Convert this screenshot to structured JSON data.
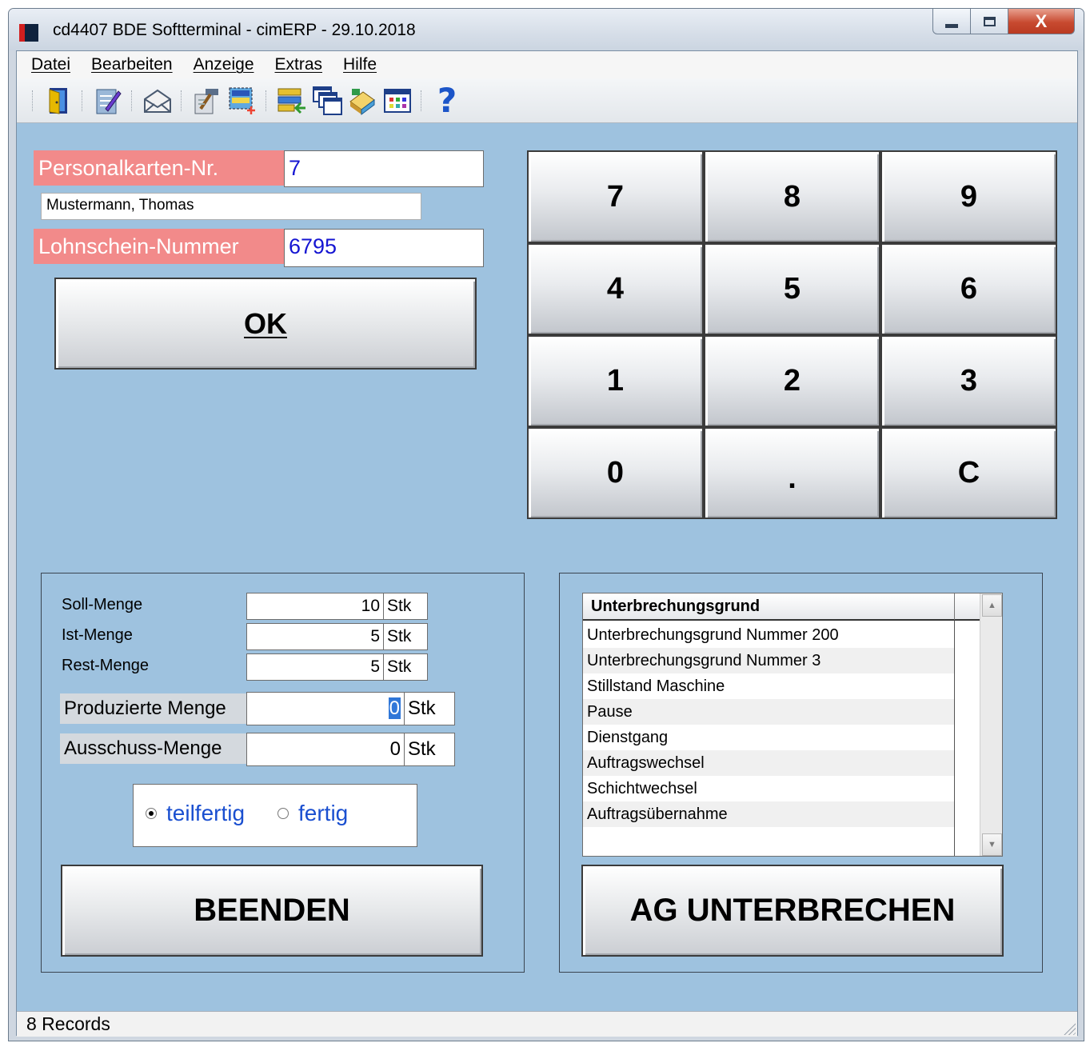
{
  "window": {
    "title": "cd4407 BDE Softterminal - cimERP - 29.10.2018",
    "close_glyph": "X"
  },
  "menu": [
    {
      "label": "Datei"
    },
    {
      "label": "Bearbeiten"
    },
    {
      "label": "Anzeige"
    },
    {
      "label": "Extras"
    },
    {
      "label": "Hilfe"
    }
  ],
  "toolbar": {
    "icons": [
      "exit-door-icon",
      "edit-notes-icon",
      "mail-icon",
      "hammer-edit-icon",
      "new-record-icon",
      "transfer-icon",
      "windows-icon",
      "book-icon",
      "table-icon",
      "help-icon"
    ],
    "help_glyph": "?"
  },
  "login": {
    "personal_label": "Personalkarten-Nr.",
    "personal_value": "7",
    "employee_name": "Mustermann, Thomas",
    "lohnschein_label": "Lohnschein-Nummer",
    "lohnschein_value": "6795",
    "ok_label": "OK"
  },
  "keypad": {
    "keys": [
      "7",
      "8",
      "9",
      "4",
      "5",
      "6",
      "1",
      "2",
      "3",
      "0",
      ".",
      "C"
    ]
  },
  "quantities": {
    "soll_label": "Soll-Menge",
    "soll_value": "10",
    "ist_label": "Ist-Menge",
    "ist_value": "5",
    "rest_label": "Rest-Menge",
    "rest_value": "5",
    "unit": "Stk",
    "produziert_label": "Produzierte Menge",
    "produziert_value": "0",
    "ausschuss_label": "Ausschuss-Menge",
    "ausschuss_value": "0",
    "radio_teilfertig": "teilfertig",
    "radio_fertig": "fertig",
    "selected_radio": "teilfertig",
    "beenden_label": "BEENDEN"
  },
  "interrupt": {
    "column_header": "Unterbrechungsgrund",
    "reasons": [
      "Unterbrechungsgrund Nummer 200",
      "Unterbrechungsgrund Nummer 3",
      "Stillstand Maschine",
      "Pause",
      "Dienstgang",
      "Auftragswechsel",
      "Schichtwechsel",
      "Auftragsübernahme"
    ],
    "button_label": "AG UNTERBRECHEN"
  },
  "status": {
    "text": "8 Records"
  },
  "colors": {
    "background": "#9ec2df",
    "label_red": "#f28a8a",
    "value_blue": "#1515d2",
    "radio_blue": "#1a4fd0"
  }
}
